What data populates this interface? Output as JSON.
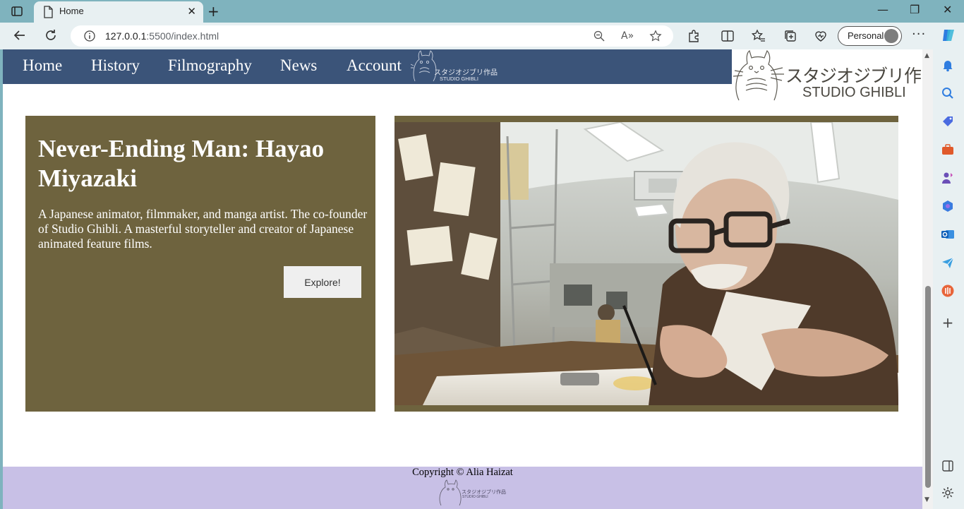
{
  "browser": {
    "tab_title": "Home",
    "url_host": "127.0.0.1",
    "url_path": ":5500/index.html",
    "profile_label": "Personal"
  },
  "site": {
    "nav": [
      "Home",
      "History",
      "Filmography",
      "News",
      "Account"
    ],
    "logo_text": {
      "japanese": "スタジオジブリ作品",
      "english": "STUDIO GHIBLI"
    },
    "hero": {
      "title": "Never-Ending Man: Hayao Miyazaki",
      "description": "A Japanese animator, filmmaker, and manga artist. The co-founder of Studio Ghibli. A masterful storyteller and creator of Japanese animated feature films.",
      "button": "Explore!"
    },
    "footer": {
      "copyright": "Copyright © Alia Haizat"
    }
  },
  "colors": {
    "nav_bg": "#3b5479",
    "card_bg": "#6e633e",
    "footer_bg": "#c8c0e6",
    "chrome_bg": "#7fb3be"
  }
}
